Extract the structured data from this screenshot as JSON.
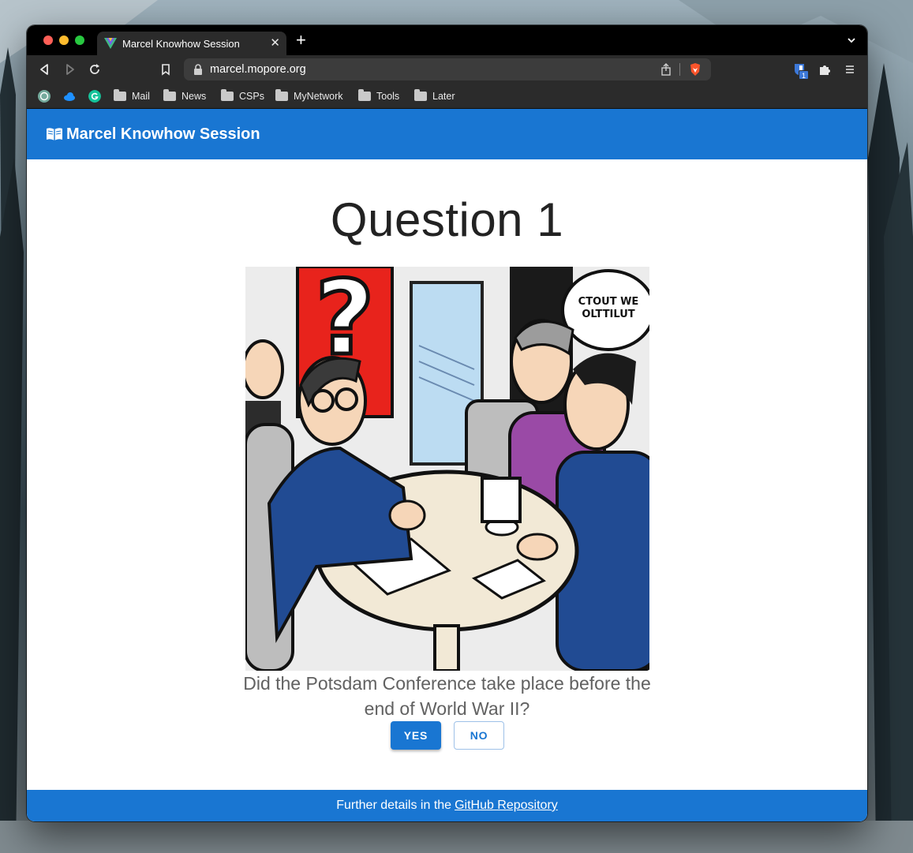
{
  "browser": {
    "tab_title": "Marcel Knowhow Session",
    "url": "marcel.mopore.org",
    "bitwarden_badge": "1",
    "bookmarks": [
      "Mail",
      "News",
      "CSPs",
      "MyNetwork",
      "Tools",
      "Later"
    ]
  },
  "app": {
    "title": "Marcel Knowhow Session",
    "title_icon": "book-open-icon",
    "accent_color": "#1976d2"
  },
  "question": {
    "heading": "Question 1",
    "text": "Did the Potsdam Conference take place before the end of World War II?",
    "illustration_speech_text": "SI CTOUT WE OLTTILUT NVTZ·",
    "yes_label": "YES",
    "no_label": "NO"
  },
  "footer": {
    "prefix": "Further details in the",
    "link_text": "GitHub Repository"
  }
}
